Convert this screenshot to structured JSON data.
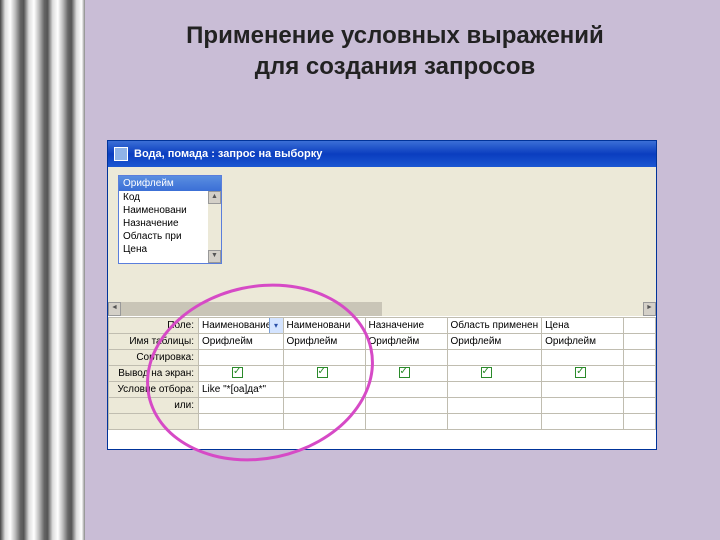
{
  "slide": {
    "title_line1": "Применение условных выражений",
    "title_line2": "для создания запросов"
  },
  "window": {
    "title": "Вода, помада : запрос на выборку"
  },
  "source_table": {
    "name": "Орифлейм",
    "fields": [
      "Код",
      "Наименовани",
      "Назначение",
      "Область при",
      "Цена"
    ]
  },
  "grid": {
    "row_labels": {
      "field": "Поле:",
      "table": "Имя таблицы:",
      "sort": "Сортировка:",
      "show": "Вывод на экран:",
      "criteria": "Условие отбора:",
      "or": "или:"
    },
    "columns": [
      {
        "field": "Наименование п",
        "table": "Орифлейм",
        "show": true,
        "criteria": "Like \"*[оа]да*\"",
        "selected": true
      },
      {
        "field": "Наименовани",
        "table": "Орифлейм",
        "show": true,
        "criteria": ""
      },
      {
        "field": "Назначение",
        "table": "Орифлейм",
        "show": true,
        "criteria": ""
      },
      {
        "field": "Область применен",
        "table": "Орифлейм",
        "show": true,
        "criteria": ""
      },
      {
        "field": "Цена",
        "table": "Орифлейм",
        "show": true,
        "criteria": ""
      }
    ]
  }
}
